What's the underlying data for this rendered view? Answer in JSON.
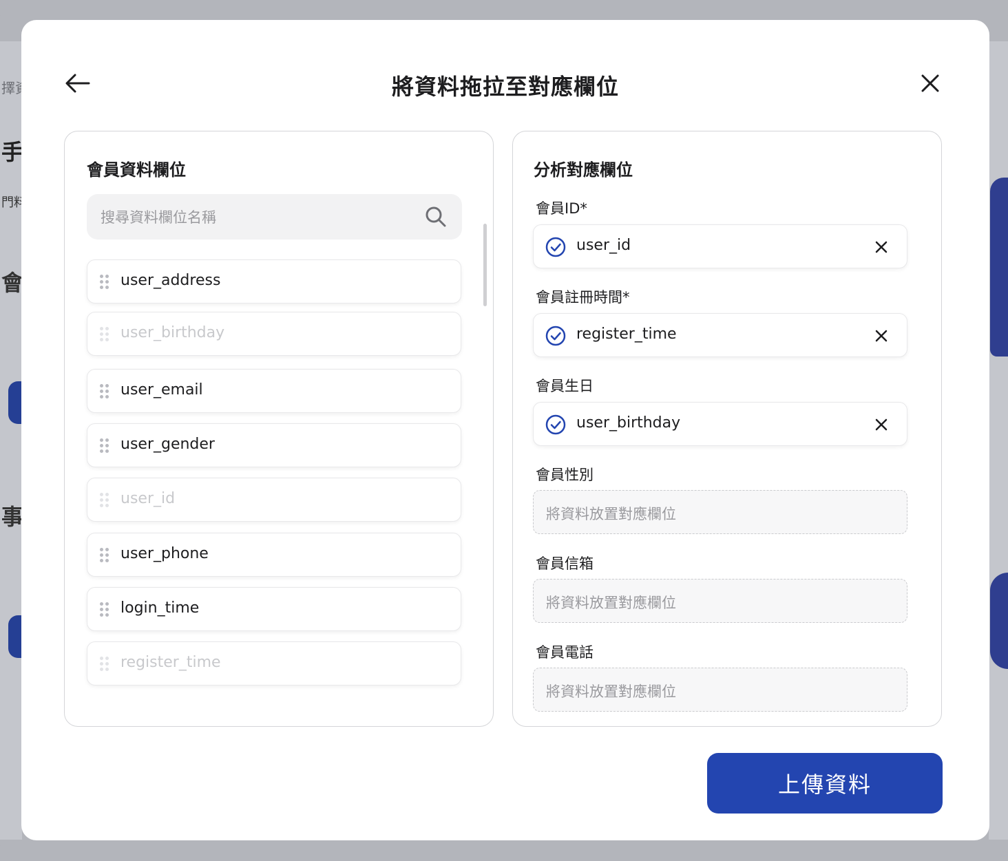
{
  "background": {
    "fragments": [
      "擇資",
      "手動",
      "門料",
      "會",
      "事"
    ]
  },
  "modal": {
    "title": "將資料拖拉至對應欄位",
    "back_icon": "arrow-left-icon",
    "close_icon": "close-icon"
  },
  "left_panel": {
    "title": "會員資料欄位",
    "search": {
      "placeholder": "搜尋資料欄位名稱",
      "value": ""
    },
    "items": [
      {
        "label": "user_address",
        "disabled": false
      },
      {
        "label": "user_birthday",
        "disabled": true
      },
      {
        "label": "user_email",
        "disabled": false
      },
      {
        "label": "user_gender",
        "disabled": false
      },
      {
        "label": "user_id",
        "disabled": true
      },
      {
        "label": "user_phone",
        "disabled": false
      },
      {
        "label": "login_time",
        "disabled": false
      },
      {
        "label": "register_time",
        "disabled": true
      }
    ]
  },
  "right_panel": {
    "title": "分析對應欄位",
    "targets": [
      {
        "label": "會員ID*",
        "value": "user_id"
      },
      {
        "label": "會員註冊時間*",
        "value": "register_time"
      },
      {
        "label": "會員生日",
        "value": "user_birthday"
      },
      {
        "label": "會員性別",
        "value": null,
        "placeholder": "將資料放置對應欄位"
      },
      {
        "label": "會員信箱",
        "value": null,
        "placeholder": "將資料放置對應欄位"
      },
      {
        "label": "會員電話",
        "value": null,
        "placeholder": "將資料放置對應欄位"
      }
    ]
  },
  "footer": {
    "upload_label": "上傳資料",
    "accent_color": "#2345b0"
  }
}
